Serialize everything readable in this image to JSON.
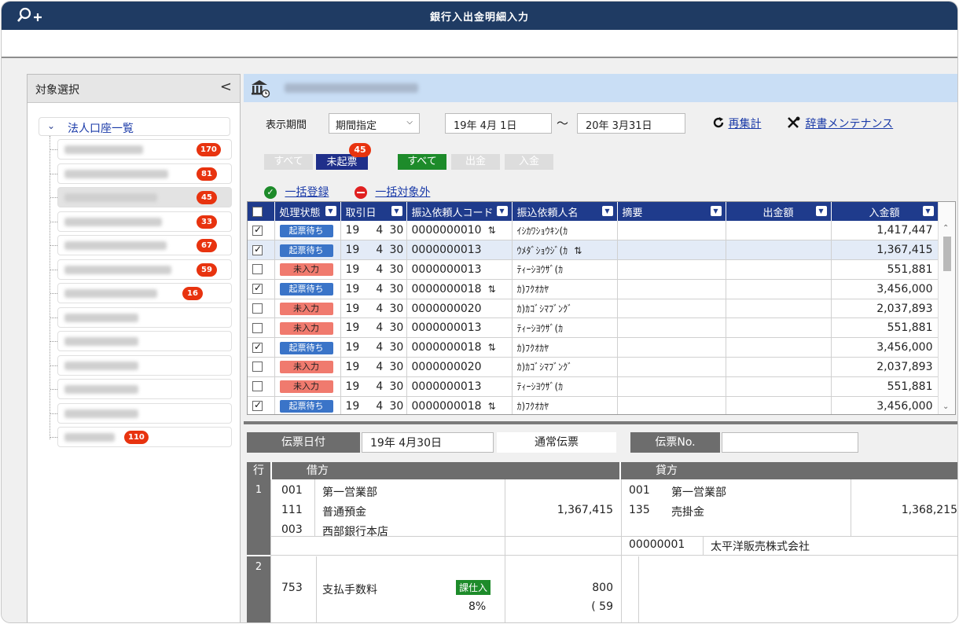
{
  "window": {
    "title": "銀行入出金明細入力",
    "app_icon": "search-plus-icon"
  },
  "left_panel": {
    "header": "対象選択",
    "collapse_glyph": "<",
    "root_label": "法人口座一覧",
    "accounts": [
      {
        "count": "170"
      },
      {
        "count": "81"
      },
      {
        "count": "45",
        "selected": true
      },
      {
        "count": "33"
      },
      {
        "count": "67"
      },
      {
        "count": "59"
      },
      {
        "count": "16"
      },
      {
        "count": ""
      },
      {
        "count": ""
      },
      {
        "count": ""
      },
      {
        "count": ""
      },
      {
        "count": ""
      },
      {
        "count": "110"
      }
    ]
  },
  "filters": {
    "period_label": "表示期間",
    "period_mode": "期間指定",
    "date_from": "19年  4月  1日",
    "tilde": "～",
    "date_to": "20年  3月31日",
    "recalc_label": "再集計",
    "dict_label": "辞書メンテナンス",
    "status_all": "すべて",
    "status_unposted": "未起票",
    "unposted_count": "45",
    "type_all": "すべて",
    "type_out": "出金",
    "type_in": "入金",
    "bulk_register": "一括登録",
    "bulk_exclude": "一括対象外"
  },
  "table": {
    "columns": [
      "処理状態",
      "取引日",
      "振込依頼人コード",
      "振込依頼人名",
      "摘要",
      "出金額",
      "入金額"
    ],
    "rows": [
      {
        "checked": true,
        "status": "起票待ち",
        "st": "wait",
        "y": "19",
        "m": "4",
        "d": "30",
        "code": "0000000010",
        "swap": true,
        "name": "ｲｼｶﾜｼｮｳｷﾝ(ｶ",
        "memo": "",
        "out": "",
        "in": "1,417,447"
      },
      {
        "checked": true,
        "status": "起票待ち",
        "st": "wait",
        "y": "19",
        "m": "4",
        "d": "30",
        "code": "0000000013",
        "swap": false,
        "name": "ｳﾒﾀﾞｼｮｳｼﾞ(ｶ",
        "name_swap": true,
        "memo": "",
        "out": "",
        "in": "1,367,415",
        "hl": true
      },
      {
        "checked": false,
        "status": "未入力",
        "st": "none",
        "y": "19",
        "m": "4",
        "d": "30",
        "code": "0000000013",
        "swap": false,
        "name": "ﾃｨｰｼﾖｳｻﾞ(ｶ",
        "memo": "",
        "out": "",
        "in": "551,881"
      },
      {
        "checked": true,
        "status": "起票待ち",
        "st": "wait",
        "y": "19",
        "m": "4",
        "d": "30",
        "code": "0000000018",
        "swap": true,
        "name": "ｶ)ﾌｸｵｶﾔ",
        "memo": "",
        "out": "",
        "in": "3,456,000"
      },
      {
        "checked": false,
        "status": "未入力",
        "st": "none",
        "y": "19",
        "m": "4",
        "d": "30",
        "code": "0000000020",
        "swap": false,
        "name": "ｶ)ｶｺﾞｼﾏﾌﾞﾝｸﾞ",
        "memo": "",
        "out": "",
        "in": "2,037,893"
      },
      {
        "checked": false,
        "status": "未入力",
        "st": "none",
        "y": "19",
        "m": "4",
        "d": "30",
        "code": "0000000013",
        "swap": false,
        "name": "ﾃｨｰｼﾖｳｻﾞ(ｶ",
        "memo": "",
        "out": "",
        "in": "551,881"
      },
      {
        "checked": true,
        "status": "起票待ち",
        "st": "wait",
        "y": "19",
        "m": "4",
        "d": "30",
        "code": "0000000018",
        "swap": true,
        "name": "ｶ)ﾌｸｵｶﾔ",
        "memo": "",
        "out": "",
        "in": "3,456,000"
      },
      {
        "checked": false,
        "status": "未入力",
        "st": "none",
        "y": "19",
        "m": "4",
        "d": "30",
        "code": "0000000020",
        "swap": false,
        "name": "ｶ)ｶｺﾞｼﾏﾌﾞﾝｸﾞ",
        "memo": "",
        "out": "",
        "in": "2,037,893"
      },
      {
        "checked": false,
        "status": "未入力",
        "st": "none",
        "y": "19",
        "m": "4",
        "d": "30",
        "code": "0000000013",
        "swap": false,
        "name": "ﾃｨｰｼﾖｳｻﾞ(ｶ",
        "memo": "",
        "out": "",
        "in": "551,881"
      },
      {
        "checked": true,
        "status": "起票待ち",
        "st": "wait",
        "y": "19",
        "m": "4",
        "d": "30",
        "code": "0000000018",
        "swap": true,
        "name": "ｶ)ﾌｸｵｶﾔ",
        "memo": "",
        "out": "",
        "in": "3,456,000"
      }
    ]
  },
  "voucher": {
    "date_label": "伝票日付",
    "date_value": "19年  4月30日",
    "type_value": "通常伝票",
    "no_label": "伝票No.",
    "no_value": ""
  },
  "journal": {
    "row_header": "行",
    "debit_header": "借方",
    "credit_header": "貸方",
    "line1": {
      "no": "1",
      "debit_dept_code": "001",
      "debit_dept": "第一営業部",
      "debit_acct_code": "111",
      "debit_acct": "普通預金",
      "debit_sub_code": "003",
      "debit_sub": "西部銀行本店",
      "debit_amount": "1,367,415",
      "credit_dept_code": "001",
      "credit_dept": "第一営業部",
      "credit_acct_code": "135",
      "credit_acct": "売掛金",
      "credit_amount": "1,368,215",
      "partner_code": "00000001",
      "partner": "太平洋販売株式会社"
    },
    "line2": {
      "no": "2",
      "debit_acct_code": "753",
      "debit_acct": "支払手数料",
      "tax_badge": "課仕入",
      "tax_rate": "8%",
      "debit_amount": "800",
      "tax_amount": "( 59"
    }
  }
}
